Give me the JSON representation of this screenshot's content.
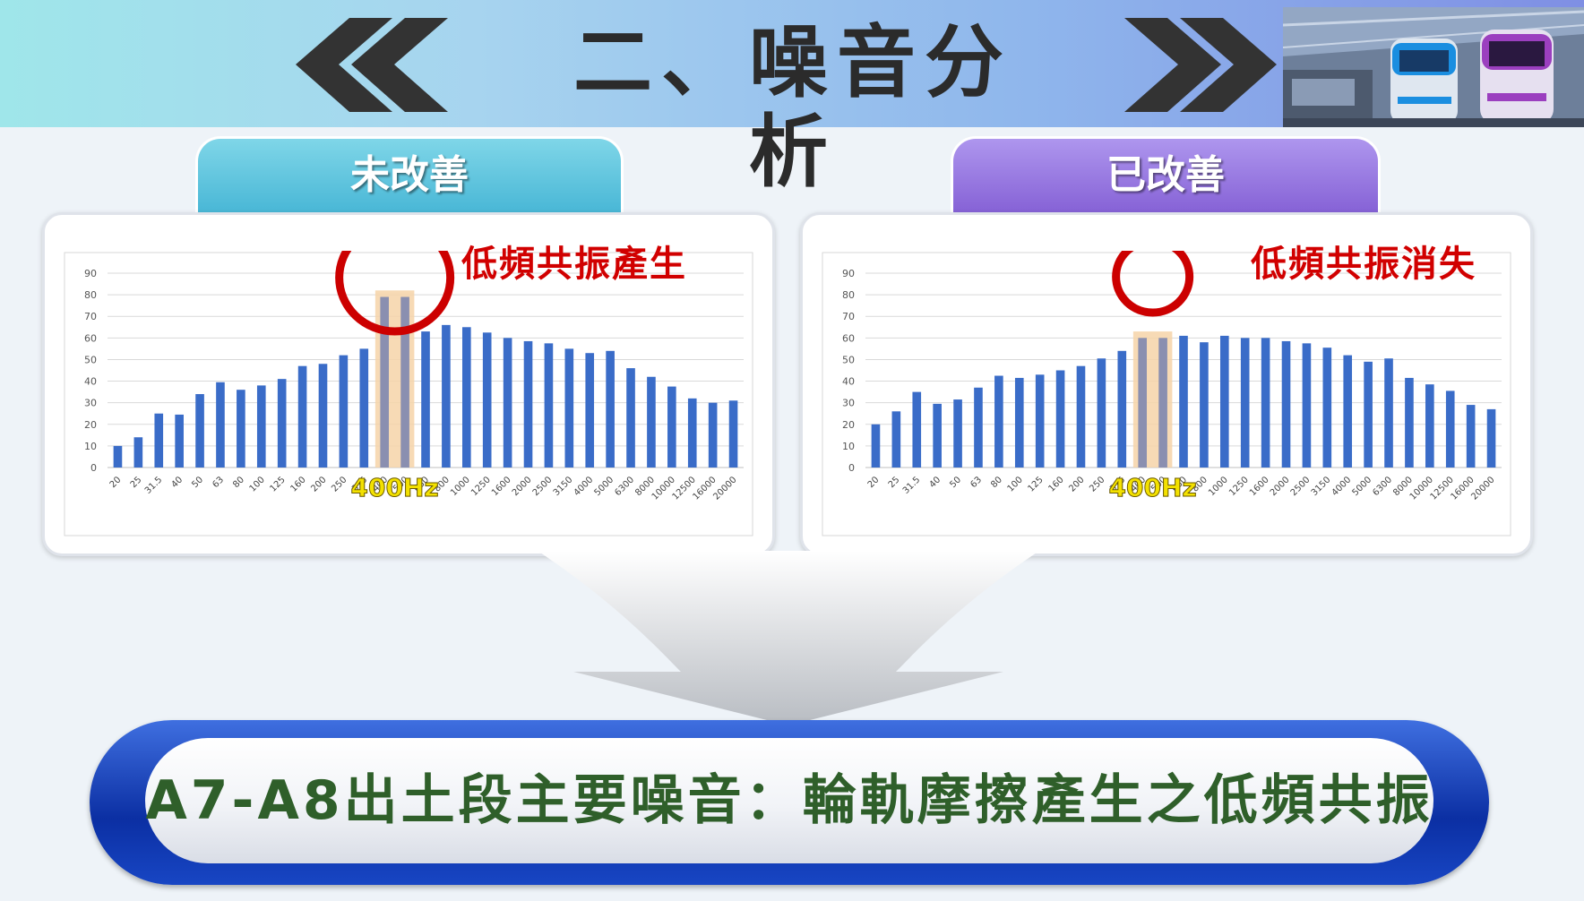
{
  "header": {
    "title": "二、噪音分析"
  },
  "tabs": {
    "before": "未改善",
    "after": "已改善"
  },
  "colors": {
    "bar": "#3a6cc8",
    "highlight_band": "#f6d3a8",
    "circle": "#cc0000",
    "highlight_label": "#f3e100"
  },
  "charts": {
    "before": {
      "annotation": "低頻共振產生",
      "highlight_label": "400Hz"
    },
    "after": {
      "annotation": "低頻共振消失",
      "highlight_label": "400Hz"
    }
  },
  "chart_data": [
    {
      "type": "bar",
      "categories": [
        "20",
        "25",
        "31.5",
        "40",
        "50",
        "63",
        "80",
        "100",
        "125",
        "160",
        "200",
        "250",
        "315",
        "400",
        "500",
        "630",
        "800",
        "1000",
        "1250",
        "1600",
        "2000",
        "2500",
        "3150",
        "4000",
        "5000",
        "6300",
        "8000",
        "10000",
        "12500",
        "16000",
        "20000"
      ],
      "values": [
        10,
        14,
        25,
        24.5,
        34,
        39.5,
        36,
        38,
        41,
        47,
        48,
        52,
        55,
        79,
        79,
        63,
        66,
        65,
        62.5,
        60,
        58.5,
        57.5,
        55,
        53,
        54,
        46,
        42,
        37.5,
        32,
        30,
        31
      ],
      "ylim": [
        0,
        90
      ],
      "yticks": [
        0,
        10,
        20,
        30,
        40,
        50,
        60,
        70,
        80,
        90
      ],
      "highlight_categories": [
        "400",
        "500"
      ],
      "grid": true
    },
    {
      "type": "bar",
      "categories": [
        "20",
        "25",
        "31.5",
        "40",
        "50",
        "63",
        "80",
        "100",
        "125",
        "160",
        "200",
        "250",
        "315",
        "400",
        "500",
        "630",
        "800",
        "1000",
        "1250",
        "1600",
        "2000",
        "2500",
        "3150",
        "4000",
        "5000",
        "6300",
        "8000",
        "10000",
        "12500",
        "16000",
        "20000"
      ],
      "values": [
        20,
        26,
        35,
        29.5,
        31.5,
        37,
        42.5,
        41.5,
        43,
        45,
        47,
        50.5,
        54,
        60,
        60,
        61,
        58,
        61,
        60,
        60,
        58.5,
        57.5,
        55.5,
        52,
        49,
        50.5,
        41.5,
        38.5,
        35.5,
        29,
        27
      ],
      "ylim": [
        0,
        90
      ],
      "yticks": [
        0,
        10,
        20,
        30,
        40,
        50,
        60,
        70,
        80,
        90
      ],
      "highlight_categories": [
        "400",
        "500"
      ],
      "grid": true
    }
  ],
  "conclusion": "A7-A8出土段主要噪音：輪軌摩擦產生之低頻共振"
}
